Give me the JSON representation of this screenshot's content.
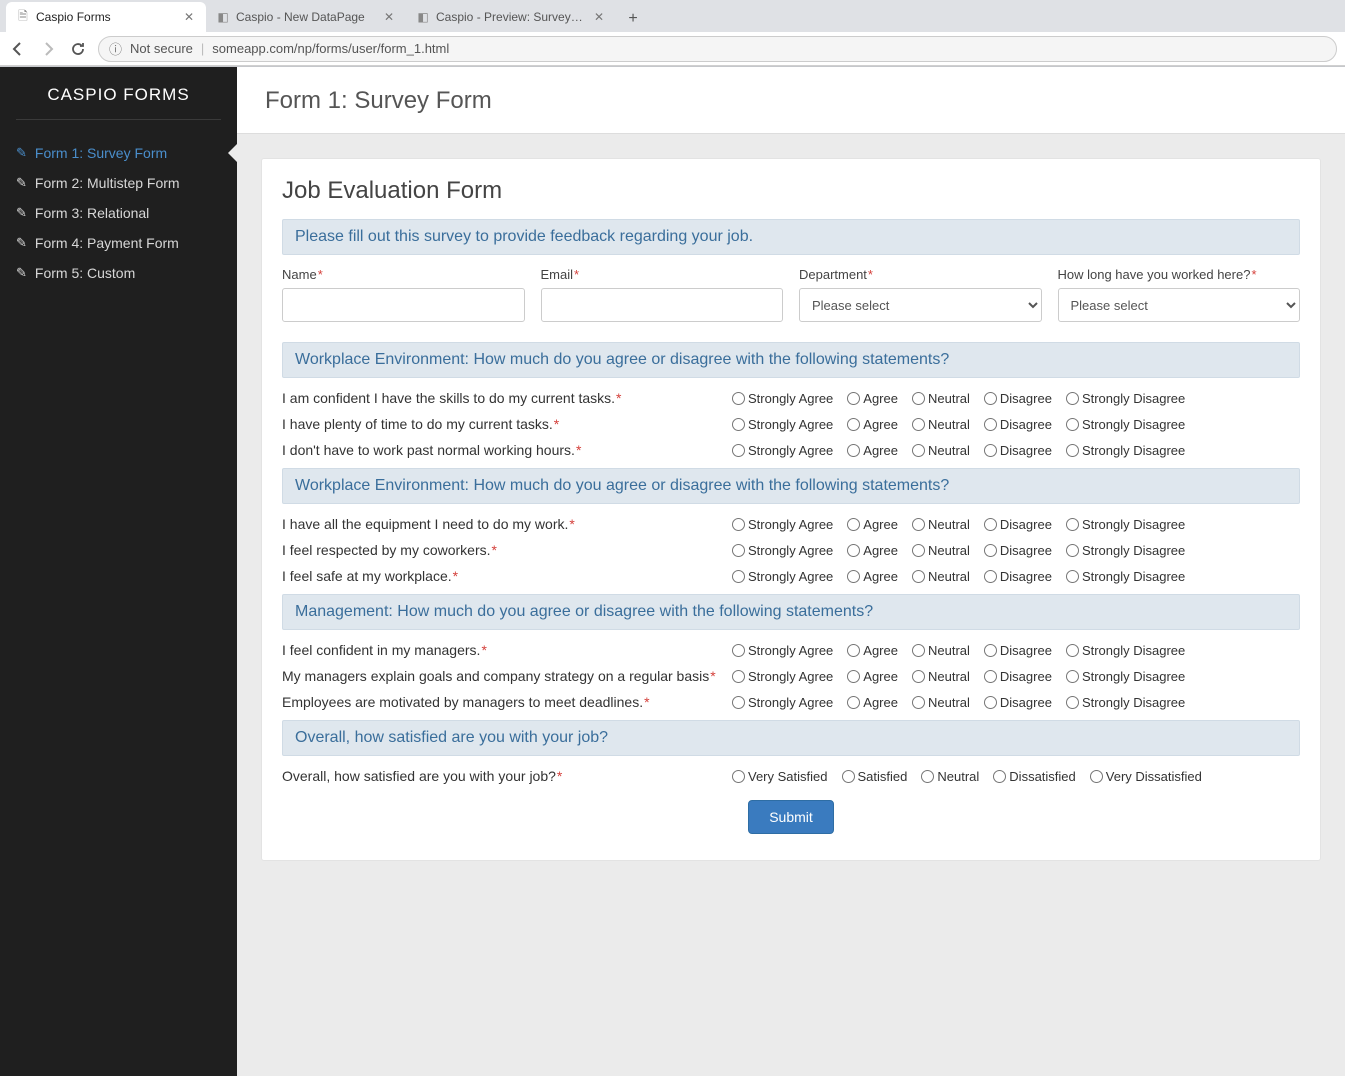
{
  "browser": {
    "tabs": [
      {
        "title": "Caspio Forms",
        "active": true
      },
      {
        "title": "Caspio - New DataPage",
        "active": false
      },
      {
        "title": "Caspio - Preview: Survey Form",
        "active": false
      }
    ],
    "security_label": "Not secure",
    "url": "someapp.com/np/forms/user/form_1.html"
  },
  "sidebar": {
    "brand": "CASPIO FORMS",
    "items": [
      {
        "label": "Form 1: Survey Form",
        "active": true
      },
      {
        "label": "Form 2: Multistep Form",
        "active": false
      },
      {
        "label": "Form 3: Relational",
        "active": false
      },
      {
        "label": "Form 4: Payment Form",
        "active": false
      },
      {
        "label": "Form 5: Custom",
        "active": false
      }
    ]
  },
  "page_title": "Form 1: Survey Form",
  "form": {
    "title": "Job Evaluation Form",
    "intro": "Please fill out this survey to provide feedback regarding your job.",
    "fields": {
      "name_label": "Name",
      "email_label": "Email",
      "dept_label": "Department",
      "tenure_label": "How long have you worked here?",
      "select_placeholder": "Please select"
    },
    "likert_options": [
      "Strongly Agree",
      "Agree",
      "Neutral",
      "Disagree",
      "Strongly Disagree"
    ],
    "sections": [
      {
        "heading": "Workplace Environment: How much do you agree or disagree with the following statements?",
        "questions": [
          "I am confident I have the skills to do my current tasks.",
          "I have plenty of time to do my current tasks.",
          "I don't have to work past normal working hours."
        ]
      },
      {
        "heading": "Workplace Environment: How much do you agree or disagree with the following statements?",
        "questions": [
          "I have all the equipment I need to do my work.",
          "I feel respected by my coworkers.",
          "I feel safe at my workplace."
        ]
      },
      {
        "heading": "Management: How much do you agree or disagree with the following statements?",
        "questions": [
          "I feel confident in my managers.",
          "My managers explain goals and company strategy on a regular basis",
          "Employees are motivated by managers to meet deadlines."
        ]
      }
    ],
    "overall": {
      "heading": "Overall, how satisfied are you with your job?",
      "question": "Overall, how satisfied are you with your job?",
      "options": [
        "Very Satisfied",
        "Satisfied",
        "Neutral",
        "Dissatisfied",
        "Very Dissatisfied"
      ]
    },
    "submit_label": "Submit"
  }
}
